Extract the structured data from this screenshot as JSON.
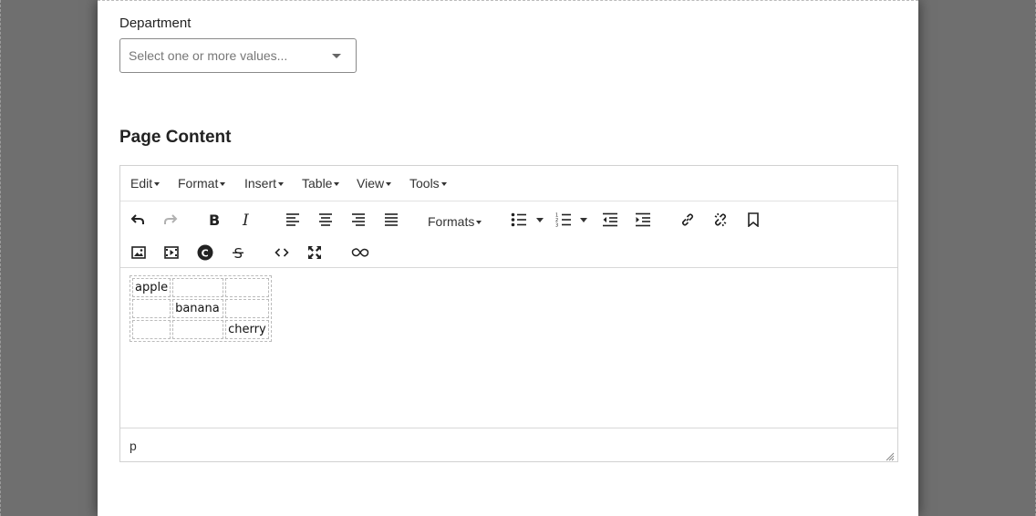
{
  "department": {
    "label": "Department",
    "placeholder": "Select one or more values..."
  },
  "page_content": {
    "title": "Page Content"
  },
  "editor": {
    "menu": [
      {
        "label": "Edit"
      },
      {
        "label": "Format"
      },
      {
        "label": "Insert"
      },
      {
        "label": "Table"
      },
      {
        "label": "View"
      },
      {
        "label": "Tools"
      }
    ],
    "toolbar": {
      "formats_label": "Formats",
      "icons": [
        "undo-icon",
        "redo-icon",
        "bold-icon",
        "italic-icon",
        "align-left-icon",
        "align-center-icon",
        "align-right-icon",
        "align-justify-icon",
        "bullet-list-icon",
        "numbered-list-icon",
        "outdent-icon",
        "indent-icon",
        "link-icon",
        "unlink-icon",
        "bookmark-icon",
        "image-icon",
        "media-icon",
        "copyright-icon",
        "strikethrough-icon",
        "code-icon",
        "fullscreen-icon",
        "infinity-icon"
      ]
    },
    "table": {
      "rows": [
        [
          "apple",
          "",
          ""
        ],
        [
          "",
          "banana",
          ""
        ],
        [
          "",
          "",
          "cherry"
        ]
      ]
    },
    "status_path": "p"
  }
}
